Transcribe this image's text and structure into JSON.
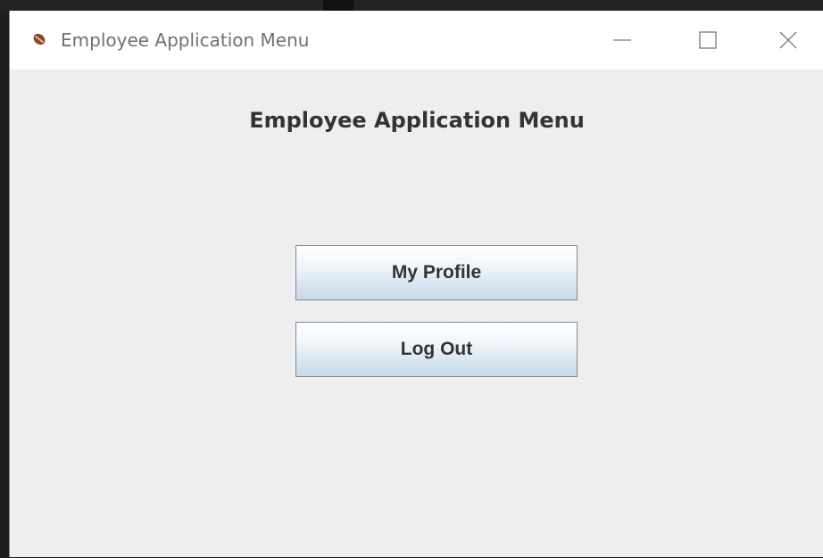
{
  "window": {
    "title": "Employee Application Menu",
    "icon": "java-coffee-icon",
    "controls": {
      "minimize_icon": "minimize-icon",
      "maximize_icon": "maximize-icon",
      "close_icon": "close-icon"
    }
  },
  "main": {
    "heading": "Employee Application Menu",
    "buttons": [
      {
        "label": "My Profile"
      },
      {
        "label": "Log Out"
      }
    ]
  },
  "colors": {
    "client_background": "#eeeeee",
    "titlebar_background": "#ffffff",
    "button_gradient_top": "#ffffff",
    "button_gradient_bottom": "#c9d9e8",
    "button_border": "#7a8a99",
    "text": "#333333"
  }
}
